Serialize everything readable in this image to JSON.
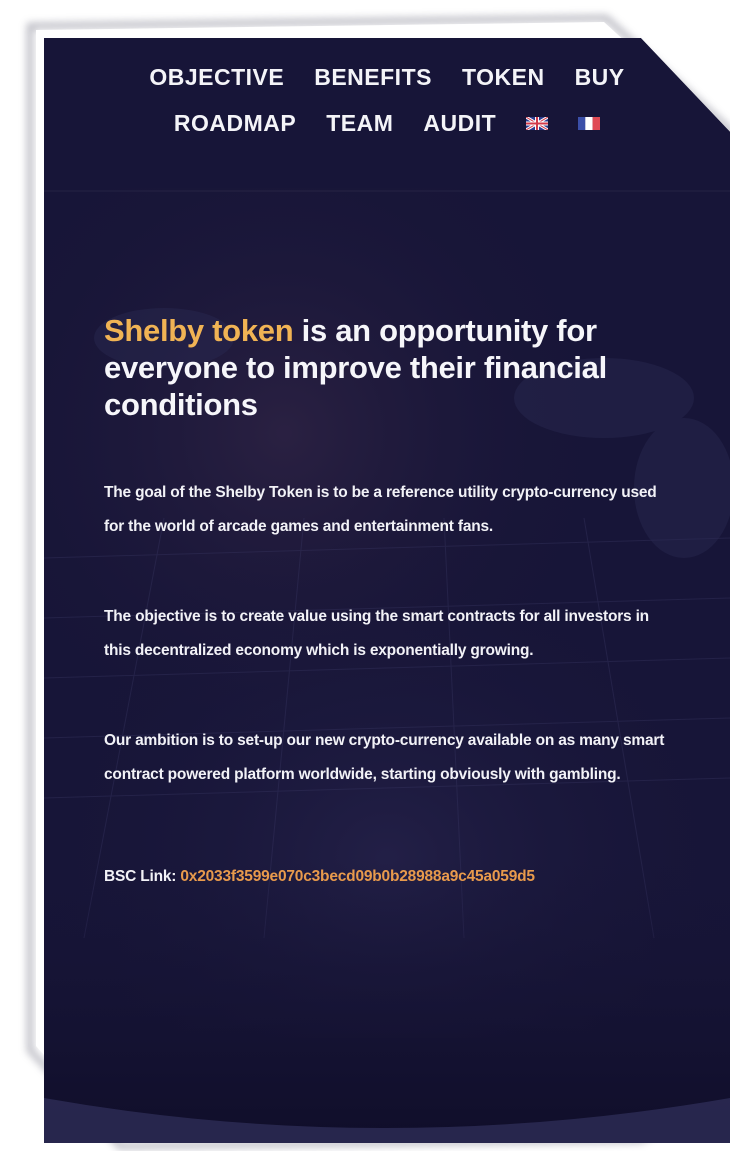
{
  "nav": {
    "row1": [
      "OBJECTIVE",
      "BENEFITS",
      "TOKEN",
      "BUY"
    ],
    "row2": [
      "ROADMAP",
      "TEAM",
      "AUDIT"
    ],
    "flags": [
      "uk-flag-icon",
      "france-flag-icon"
    ]
  },
  "headline": {
    "accent": "Shelby token",
    "rest": " is an opportunity for everyone to improve their financial conditions"
  },
  "paragraphs": [
    "The goal of the Shelby Token is to be a reference utility crypto-currency used for the world of arcade games and entertainment fans.",
    "The objective is to create value using the smart contracts for all investors in this decentralized economy which is exponentially growing.",
    "Our ambition is to set-up our new crypto-currency available on as many smart contract powered platform worldwide, starting obviously with gambling."
  ],
  "bsc": {
    "label": "BSC Link: ",
    "address": "0x2033f3599e070c3becd09b0b28988a9c45a059d5"
  },
  "colors": {
    "background": "#161435",
    "accent": "#f0b354",
    "link": "#e89a4c",
    "text": "#f2f2f7"
  }
}
